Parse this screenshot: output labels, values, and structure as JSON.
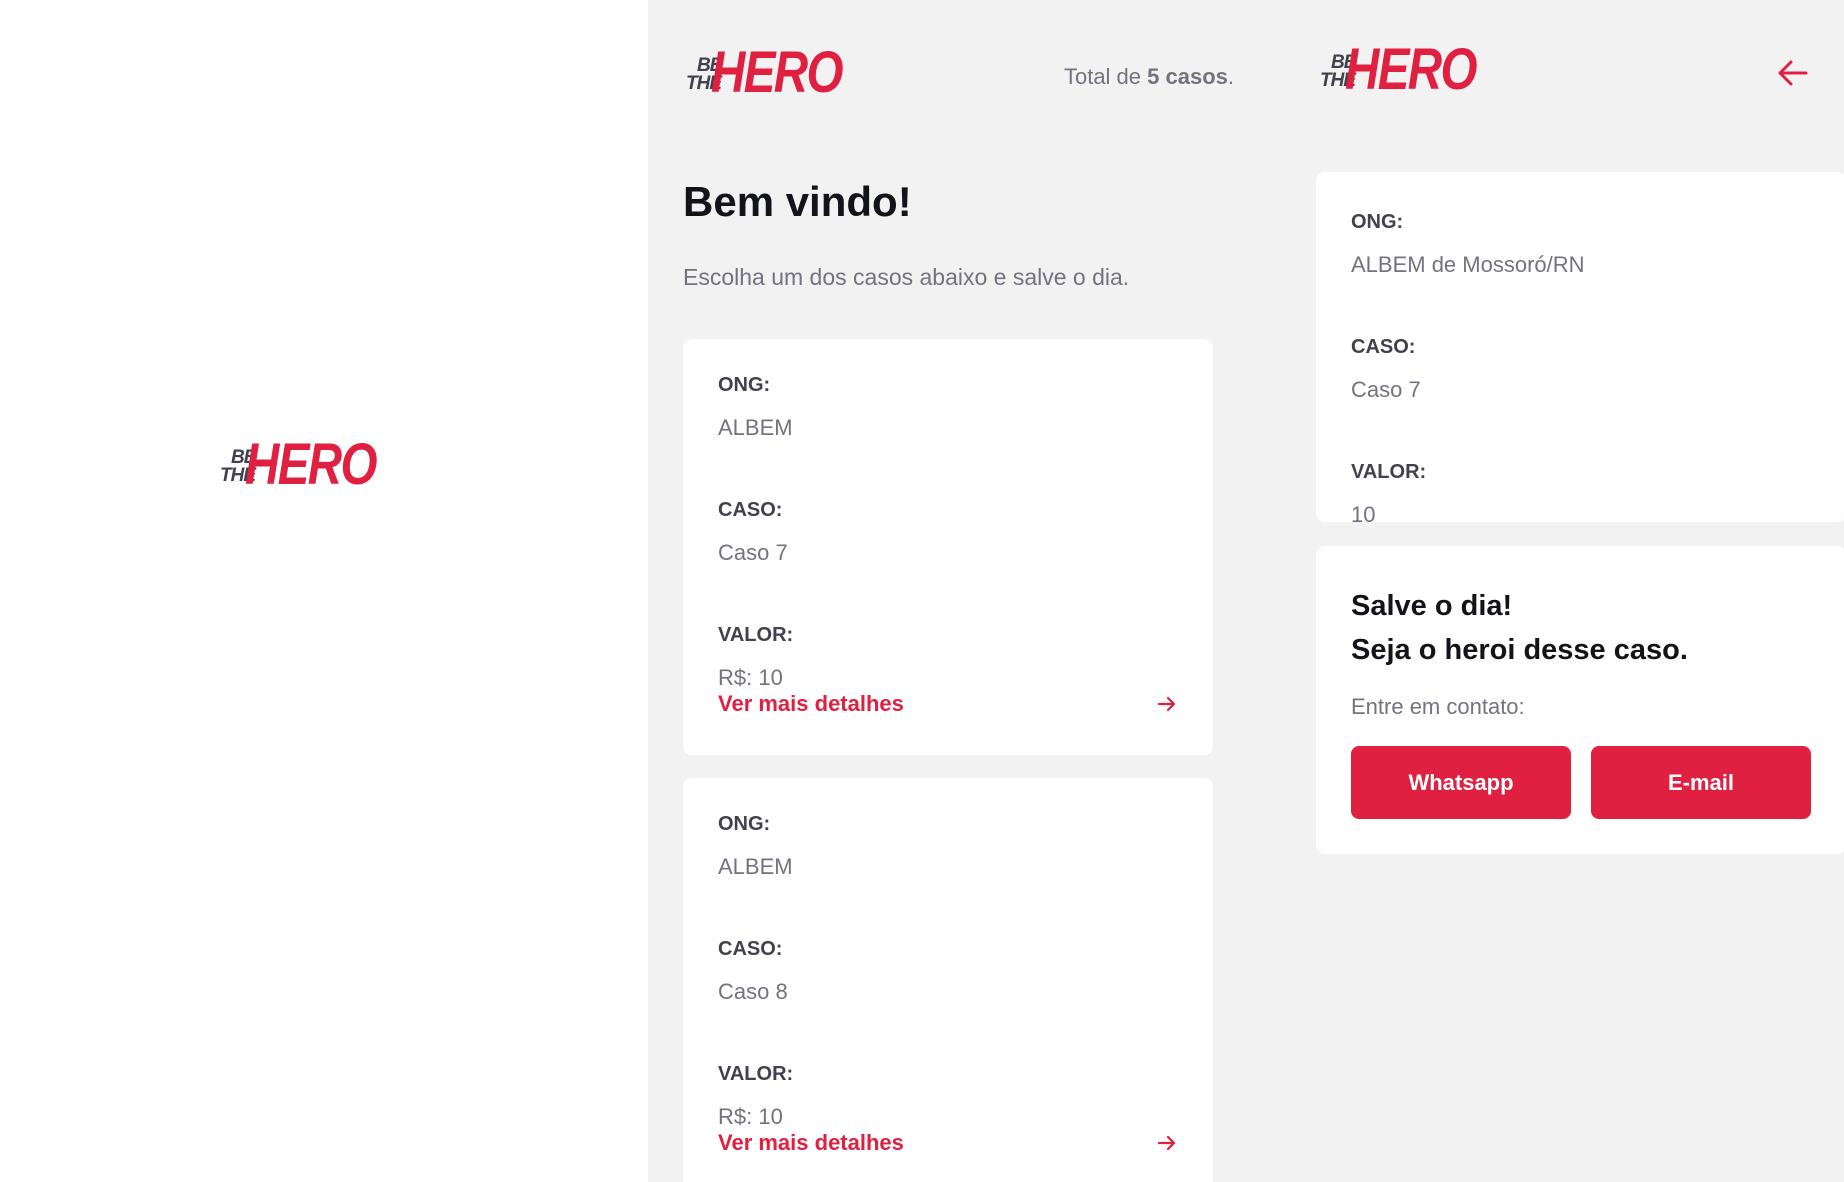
{
  "brand": {
    "be": "BE",
    "the": "THE",
    "hero": "HERO",
    "accent": "#e02041",
    "dark": "#41414d"
  },
  "list": {
    "total_prefix": "Total de ",
    "total_count": "5 casos",
    "total_suffix": ".",
    "welcome": "Bem vindo!",
    "subtitle": "Escolha um dos casos abaixo e salve o dia.",
    "incidents": [
      {
        "ong_label": "ONG:",
        "ong": "ALBEM",
        "caso_label": "CASO:",
        "caso": "Caso 7",
        "valor_label": "VALOR:",
        "valor": "R$: 10",
        "link": "Ver mais detalhes"
      },
      {
        "ong_label": "ONG:",
        "ong": "ALBEM",
        "caso_label": "CASO:",
        "caso": "Caso 8",
        "valor_label": "VALOR:",
        "valor": "R$: 10",
        "link": "Ver mais detalhes"
      }
    ]
  },
  "detail": {
    "ong_label": "ONG:",
    "ong": "ALBEM de Mossoró/RN",
    "caso_label": "CASO:",
    "caso": "Caso 7",
    "valor_label": "VALOR:",
    "valor": "10",
    "contact_title_1": "Salve o dia!",
    "contact_title_2": "Seja o heroi desse caso.",
    "contact_sub": "Entre em contato:",
    "whatsapp": "Whatsapp",
    "email": "E-mail"
  },
  "icons": {
    "back": "arrow-left-icon",
    "forward": "arrow-right-icon"
  }
}
